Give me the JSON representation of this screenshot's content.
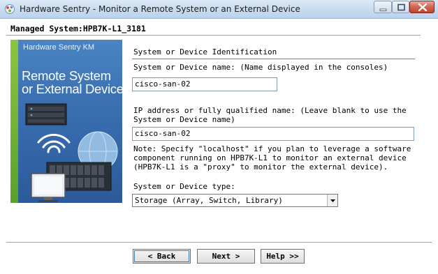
{
  "window": {
    "title": "Hardware Sentry - Monitor a Remote System or an External Device"
  },
  "header": {
    "managed_system": "Managed System:HPB7K-L1_3181"
  },
  "banner": {
    "brand": "Hardware Sentry KM",
    "title_line1": "Remote System",
    "title_line2": "or External Device"
  },
  "form": {
    "section_heading": "System or Device Identification",
    "name_label": "System or Device name: (Name displayed in the consoles)",
    "name_value": "cisco-san-02",
    "ip_label_line1": "IP address or fully qualified name: (Leave blank to use the",
    "ip_label_line2": "System or Device name)",
    "ip_value": "cisco-san-02",
    "note_line1": "Note: Specify \"localhost\" if you plan to leverage a software",
    "note_line2": "component running on HPB7K-L1 to monitor an external device",
    "note_line3": "(HPB7K-L1 is a \"proxy\" to monitor the external device).",
    "type_label": "System or Device type:",
    "type_value": "Storage (Array, Switch, Library)"
  },
  "buttons": {
    "back": "< Back",
    "next": "Next >",
    "help": "Help >>"
  },
  "colors": {
    "banner_blue": "#3a6fb2",
    "banner_green": "#8cc63f",
    "close_red": "#c24128"
  }
}
